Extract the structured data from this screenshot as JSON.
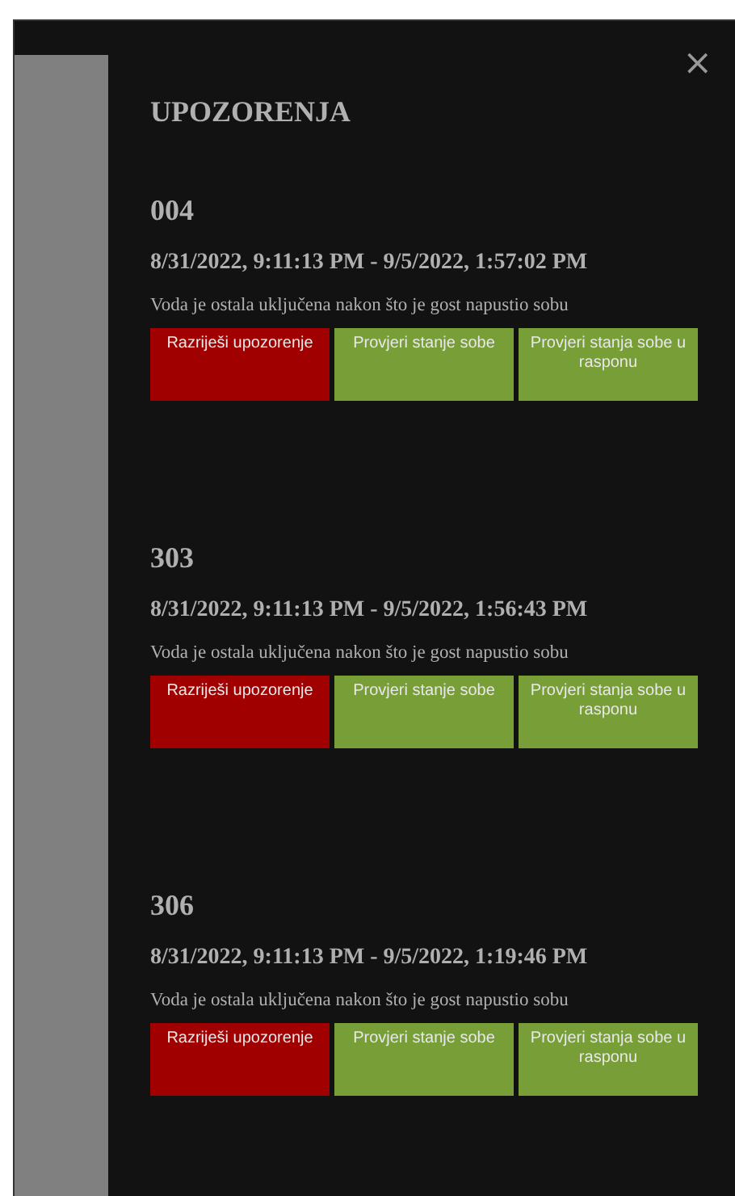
{
  "dialog": {
    "title": "UPOZORENJA",
    "close": "×"
  },
  "alerts": [
    {
      "room": "004",
      "period": "8/31/2022, 9:11:13 PM - 9/5/2022, 1:57:02 PM",
      "message": "Voda je ostala uključena nakon što je gost napustio sobu",
      "actions": [
        {
          "label": "Razriješi upozorenje",
          "kind": "danger"
        },
        {
          "label": "Provjeri stanje sobe",
          "kind": "check"
        },
        {
          "label": "Provjeri stanja sobe u rasponu",
          "kind": "check"
        }
      ]
    },
    {
      "room": "303",
      "period": "8/31/2022, 9:11:13 PM - 9/5/2022, 1:56:43 PM",
      "message": "Voda je ostala uključena nakon što je gost napustio sobu",
      "actions": [
        {
          "label": "Razriješi upozorenje",
          "kind": "danger"
        },
        {
          "label": "Provjeri stanje sobe",
          "kind": "check"
        },
        {
          "label": "Provjeri stanja sobe u rasponu",
          "kind": "check"
        }
      ]
    },
    {
      "room": "306",
      "period": "8/31/2022, 9:11:13 PM - 9/5/2022, 1:19:46 PM",
      "message": "Voda je ostala uključena nakon što je gost napustio sobu",
      "actions": [
        {
          "label": "Razriješi upozorenje",
          "kind": "danger"
        },
        {
          "label": "Provjeri stanje sobe",
          "kind": "check"
        },
        {
          "label": "Provjeri stanja sobe u rasponu",
          "kind": "check"
        }
      ]
    }
  ]
}
